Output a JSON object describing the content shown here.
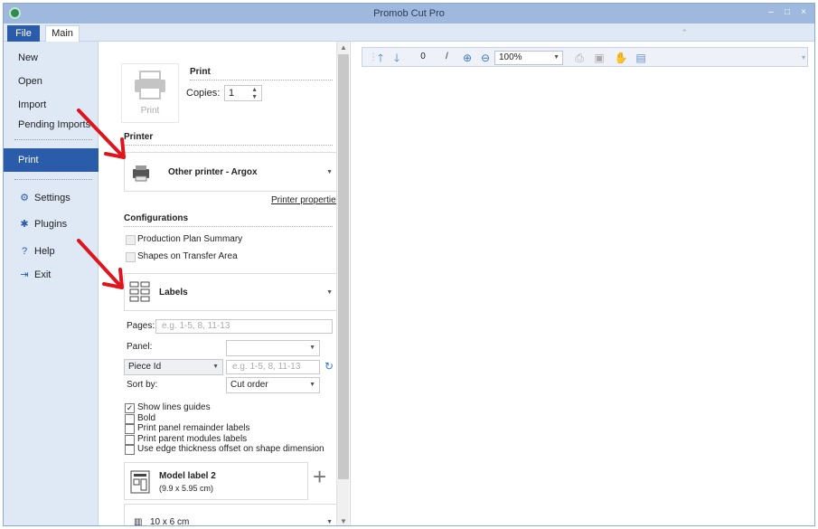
{
  "window": {
    "title": "Promob Cut Pro",
    "minimize": "–",
    "maximize": "□",
    "close": "×"
  },
  "menubar": {
    "file": "File",
    "main": "Main"
  },
  "sidebar": {
    "new": "New",
    "open": "Open",
    "import": "Import",
    "pending_imports": "Pending Imports",
    "print": "Print",
    "settings": "Settings",
    "plugins": "Plugins",
    "help": "Help",
    "exit": "Exit"
  },
  "print_section": {
    "heading": "Print",
    "button_label": "Print",
    "copies_label": "Copies:",
    "copies_value": "1"
  },
  "printer": {
    "heading": "Printer",
    "selected": "Other printer - Argox",
    "properties_link": "Printer properties"
  },
  "configurations": {
    "heading": "Configurations",
    "production_plan_summary": "Production Plan Summary",
    "shapes_on_transfer_area": "Shapes on Transfer Area",
    "report_type": "Labels",
    "pages_label": "Pages:",
    "pages_placeholder": "e.g. 1-5, 8, 11-13",
    "panel_label": "Panel:",
    "panel_value": "",
    "piece_id": "Piece Id",
    "piece_id_placeholder": "e.g. 1-5, 8, 11-13",
    "sort_by_label": "Sort by:",
    "sort_by_value": "Cut order",
    "options": [
      {
        "label": "Show lines guides",
        "checked": true
      },
      {
        "label": "Bold",
        "checked": false
      },
      {
        "label": "Print panel remainder labels",
        "checked": false
      },
      {
        "label": "Print parent modules labels",
        "checked": false
      },
      {
        "label": "Use edge thickness offset on shape dimension",
        "checked": false
      }
    ],
    "label_model_name": "Model label 2",
    "label_model_size": "(9.9 x 5.95 cm)",
    "paper_size": "10 x 6 cm"
  },
  "preview_toolbar": {
    "page_value": "0",
    "page_separator": "/",
    "zoom_value": "100%"
  },
  "colors": {
    "accent": "#2a5caa",
    "titlebar": "#9fb9de",
    "sidebar": "#dfe8f5",
    "arrow": "#e0141c"
  }
}
